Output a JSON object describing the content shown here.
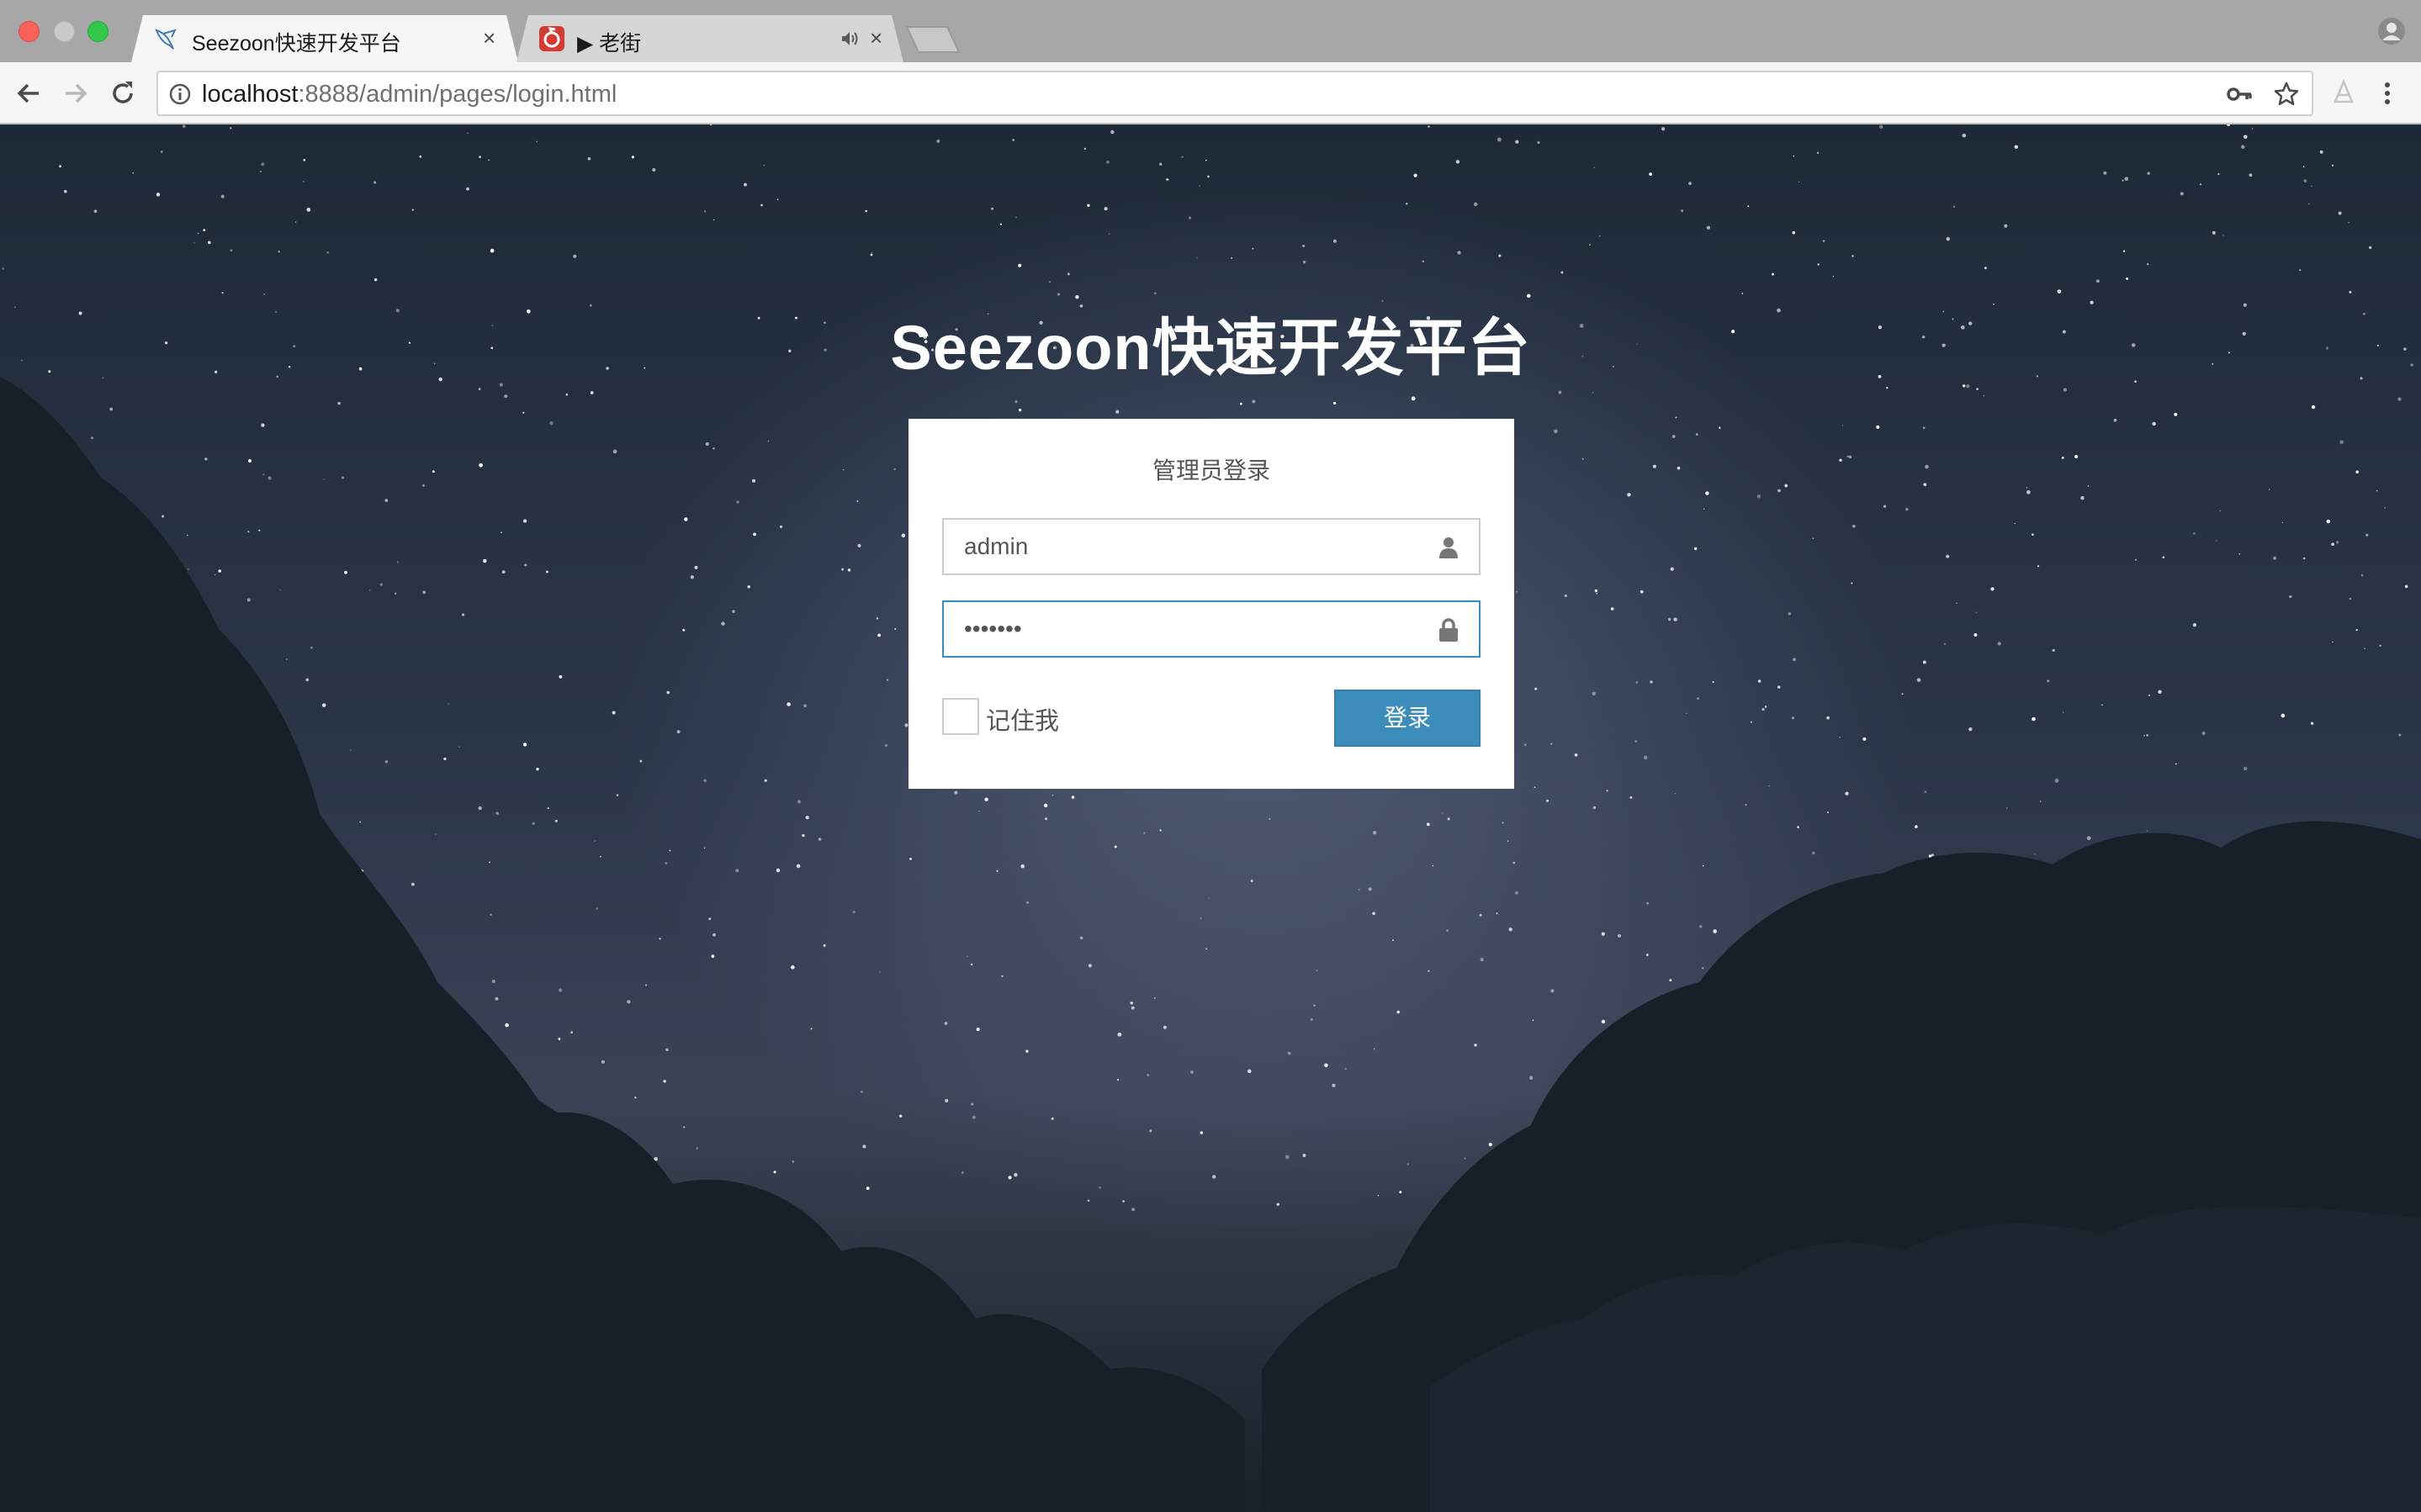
{
  "browser": {
    "tabs": [
      {
        "title": "Seezoon快速开发平台",
        "close": "×",
        "favicon": "bird-icon",
        "active": true
      },
      {
        "title": "▶ 老街",
        "close": "×",
        "favicon": "netease-music-icon",
        "audio": "speaker-icon",
        "active": false
      }
    ],
    "url_host": "localhost",
    "url_rest": ":8888/admin/pages/login.html",
    "colors": {
      "tabstrip": "#a7a7a7",
      "toolbar": "#f6f6f6"
    }
  },
  "page": {
    "title": "Seezoon快速开发平台",
    "login": {
      "box_title": "管理员登录",
      "username": {
        "value": "admin",
        "icon": "user-icon"
      },
      "password": {
        "value": "•••••••",
        "icon": "lock-icon"
      },
      "remember_label": "记住我",
      "remember_checked": false,
      "submit_label": "登录"
    },
    "colors": {
      "button": "#3c8dbc",
      "focus_border": "#3c8dbc",
      "title": "#ffffff"
    }
  }
}
